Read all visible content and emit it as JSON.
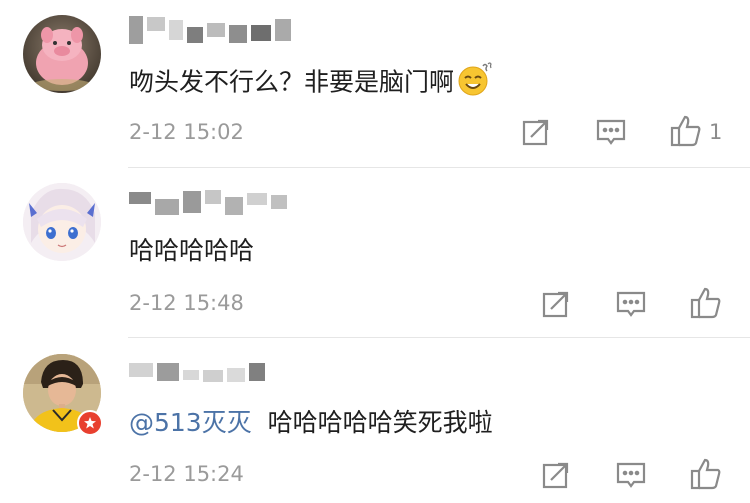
{
  "comments": [
    {
      "username_masked": "",
      "text": "吻头发不行么？非要是脑门啊",
      "emoji": "sweat-smile-emoji",
      "time": "2-12 15:02",
      "like_count": "1"
    },
    {
      "username_masked": "",
      "text": "哈哈哈哈哈",
      "time": "2-12 15:48",
      "like_count": ""
    },
    {
      "username_masked": "",
      "mention": "@513灭灭",
      "text": "哈哈哈哈哈笑死我啦",
      "time": "2-12 15:24",
      "like_count": ""
    }
  ],
  "icons": {
    "repost": "repost-icon",
    "comment": "comment-icon",
    "like": "thumbs-up-icon",
    "verified": "verified-badge-icon"
  },
  "colors": {
    "mention": "#4c73a7",
    "timestamp": "#9a9a9a",
    "icon": "#8a8a8a",
    "badge": "#e8402f"
  }
}
